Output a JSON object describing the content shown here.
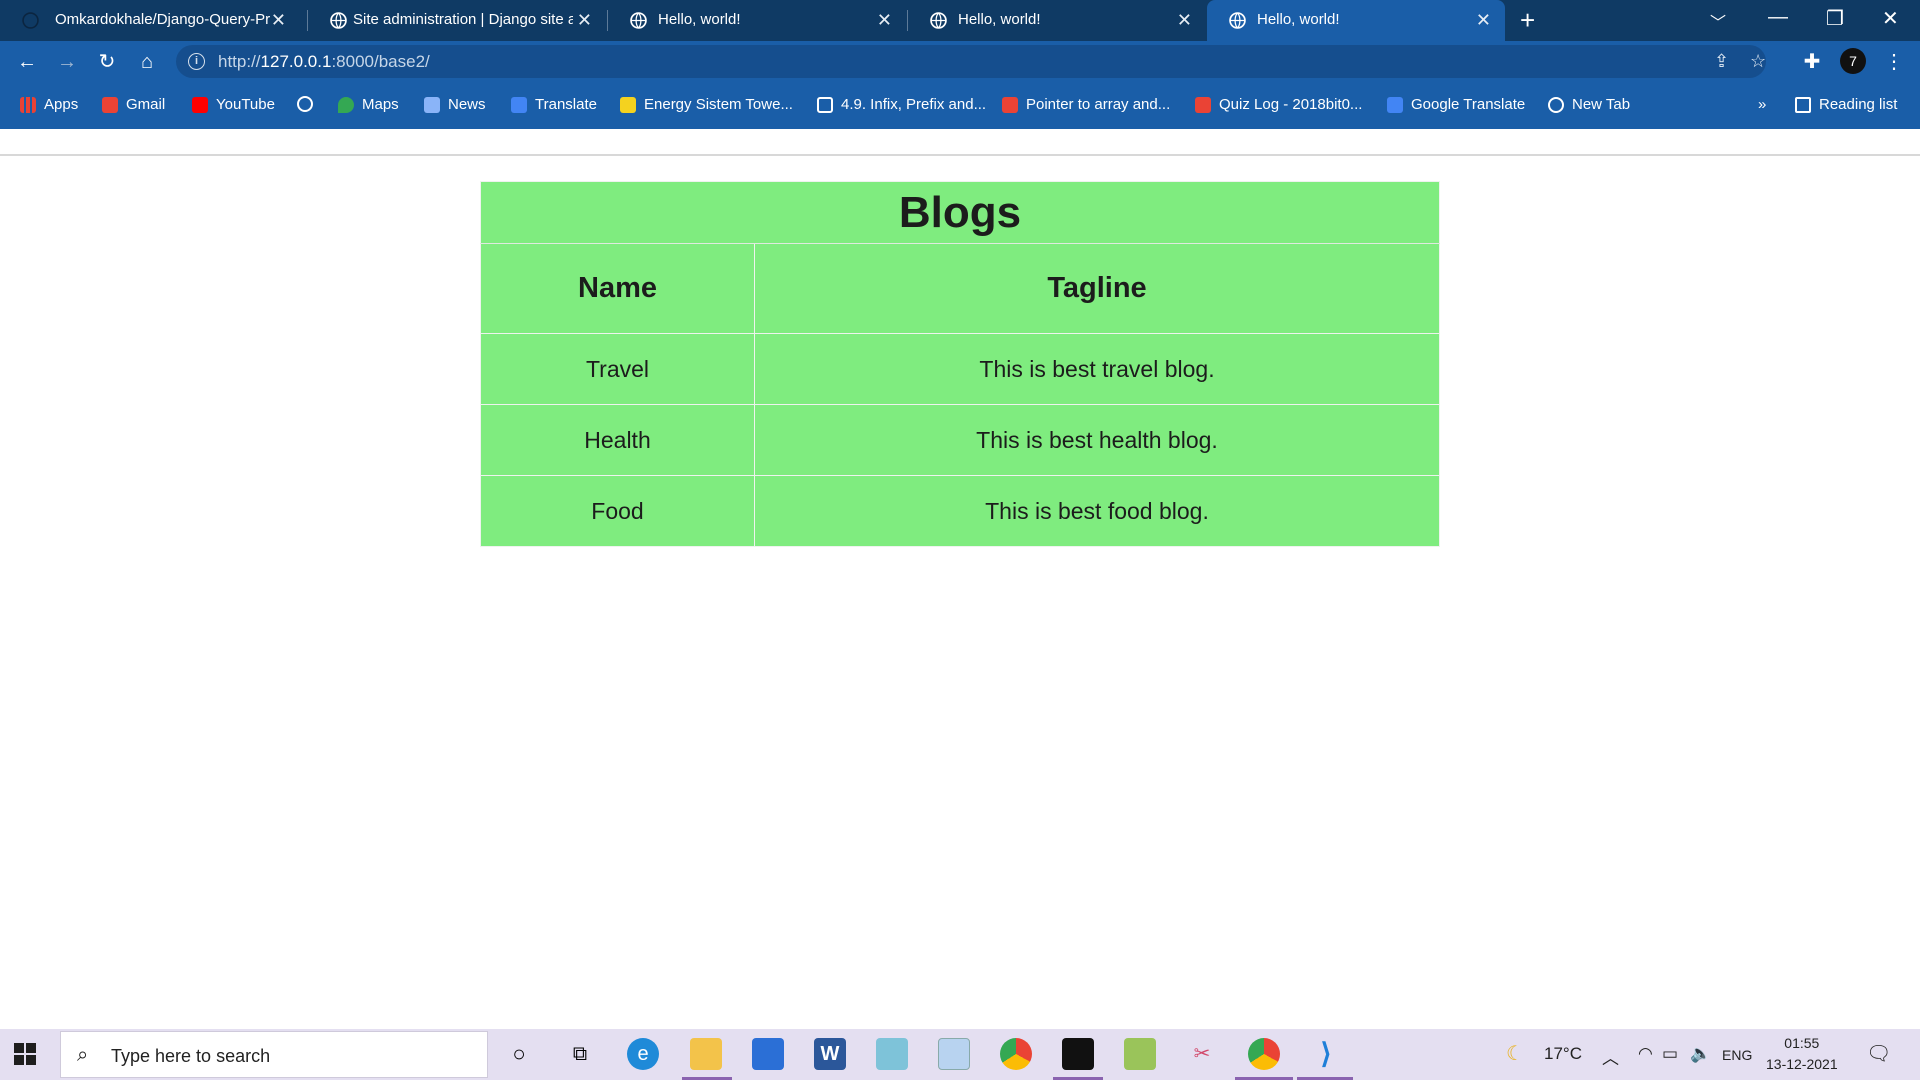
{
  "browser": {
    "tabs": [
      {
        "title": "Omkardokhale/Django-Query-Pr",
        "icon": "github-icon"
      },
      {
        "title": "Site administration | Django site a",
        "icon": "globe-icon"
      },
      {
        "title": "Hello, world!",
        "icon": "globe-icon"
      },
      {
        "title": "Hello, world!",
        "icon": "globe-icon"
      },
      {
        "title": "Hello, world!",
        "icon": "globe-icon",
        "active": true
      }
    ],
    "address": {
      "prefix": "http://",
      "host": "127.0.0.1",
      "rest": ":8000/base2/"
    },
    "profile_initial": "7",
    "bookmarks": [
      {
        "label": "Apps",
        "icon": "apps-icon"
      },
      {
        "label": "Gmail",
        "icon": "gmail-icon"
      },
      {
        "label": "YouTube",
        "icon": "youtube-icon"
      },
      {
        "label": "",
        "icon": "globe-icon"
      },
      {
        "label": "Maps",
        "icon": "maps-icon"
      },
      {
        "label": "News",
        "icon": "news-icon"
      },
      {
        "label": "Translate",
        "icon": "translate-icon"
      },
      {
        "label": "Energy Sistem Towe...",
        "icon": "energy-icon"
      },
      {
        "label": "4.9. Infix, Prefix and...",
        "icon": "book-icon"
      },
      {
        "label": "Pointer to array and...",
        "icon": "gmail-icon"
      },
      {
        "label": "Quiz Log - 2018bit0...",
        "icon": "gmail-icon"
      },
      {
        "label": "Google Translate",
        "icon": "translate-icon"
      },
      {
        "label": "New Tab",
        "icon": "globe-icon"
      }
    ],
    "bookmarks_overflow": "»",
    "reading_list": "Reading list"
  },
  "page": {
    "table_title": "Blogs",
    "headers": [
      "Name",
      "Tagline"
    ],
    "rows": [
      [
        "Travel",
        "This is best travel blog."
      ],
      [
        "Health",
        "This is best health blog."
      ],
      [
        "Food",
        "This is best food blog."
      ]
    ],
    "table_color": "#7fec7f"
  },
  "taskbar": {
    "search_placeholder": "Type here to search",
    "weather": "17°C",
    "language": "ENG",
    "time": "01:55",
    "date": "13-12-2021"
  }
}
